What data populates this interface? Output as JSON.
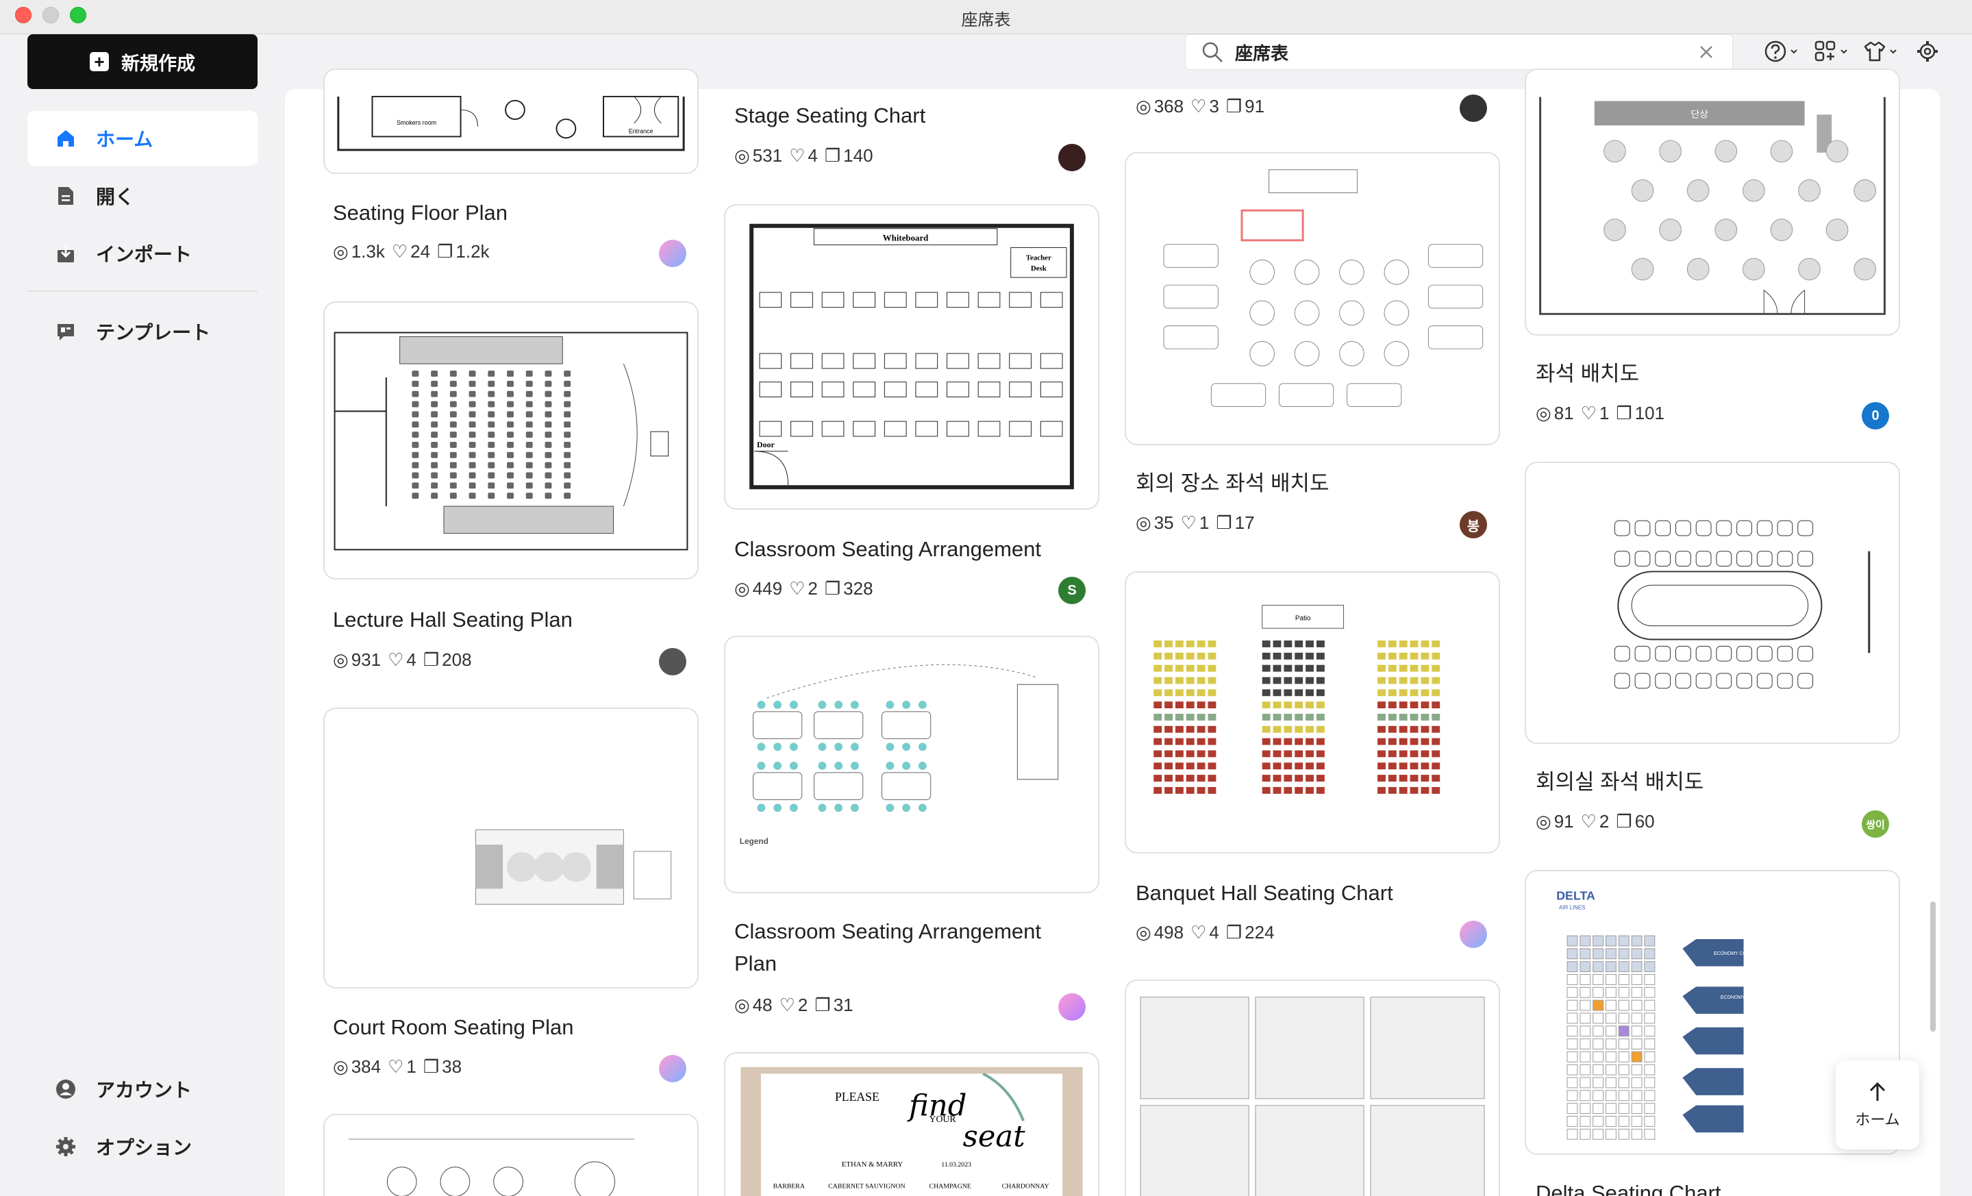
{
  "window": {
    "title": "座席表"
  },
  "sidebar": {
    "new_button": "新規作成",
    "items": [
      {
        "label": "ホーム",
        "icon": "home-icon",
        "active": true
      },
      {
        "label": "開く",
        "icon": "document-icon"
      },
      {
        "label": "インポート",
        "icon": "import-icon"
      },
      {
        "label": "テンプレート",
        "icon": "template-icon"
      }
    ],
    "bottom_items": [
      {
        "label": "アカウント",
        "icon": "account-icon"
      },
      {
        "label": "オプション",
        "icon": "gear-icon"
      }
    ]
  },
  "search": {
    "query": "座席表"
  },
  "cards": [
    {
      "title": "Seating Floor Plan",
      "views": "1.3k",
      "likes": "24",
      "copies": "1.2k"
    },
    {
      "title": "Lecture Hall Seating Plan",
      "views": "931",
      "likes": "4",
      "copies": "208"
    },
    {
      "title": "Court Room Seating Plan",
      "views": "384",
      "likes": "1",
      "copies": "38"
    },
    {
      "title": "Stage Seating Chart",
      "views": "531",
      "likes": "4",
      "copies": "140"
    },
    {
      "title": "Classroom Seating Arrangement",
      "views": "449",
      "likes": "2",
      "copies": "328",
      "avatar": "S"
    },
    {
      "title": "Classroom Seating Arrangement Plan",
      "views": "48",
      "likes": "2",
      "copies": "31"
    },
    {
      "title": "",
      "views": "368",
      "likes": "3",
      "copies": "91"
    },
    {
      "title": "회의 장소 좌석 배치도",
      "views": "35",
      "likes": "1",
      "copies": "17",
      "avatar": "봉"
    },
    {
      "title": "Banquet Hall Seating Chart",
      "views": "498",
      "likes": "4",
      "copies": "224"
    },
    {
      "title": "좌석 배치도",
      "views": "81",
      "likes": "1",
      "copies": "101",
      "avatar": "0"
    },
    {
      "title": "회의실 좌석 배치도",
      "views": "91",
      "likes": "2",
      "copies": "60",
      "avatar": "쌍이"
    },
    {
      "title": "Delta Seating Chart"
    }
  ],
  "thumb_text": {
    "whiteboard": "Whiteboard",
    "teacher_desk_1": "Teacher",
    "teacher_desk_2": "Desk",
    "door": "Door",
    "legend": "Legend",
    "smokers_room": "Smokers room",
    "entrance": "Entrance",
    "please": "PLEASE",
    "find": "find",
    "your": "YOUR",
    "seat": "seat",
    "couple": "ETHAN & MARRY",
    "date": "11.03.2023",
    "table_1": "BARBERA",
    "table_2": "CABERNET SAUVIGNON",
    "table_3": "CHAMPAGNE",
    "table_4": "CHARDONNAY",
    "delta": "DELTA",
    "delta_sub": "AIR LINES",
    "economy_comfort": "ECONOMY COMFORT",
    "economy": "ECONOMY",
    "stage_kr": "단상",
    "podium": "Patio"
  },
  "home_float": {
    "label": "ホーム"
  },
  "colors": {
    "accent": "#1677ff",
    "new_button_bg": "#111111",
    "avatar_green": "#2e7d32",
    "avatar_brown": "#6d3b2a",
    "avatar_blue": "#1677cc",
    "avatar_lime": "#7cb342"
  }
}
